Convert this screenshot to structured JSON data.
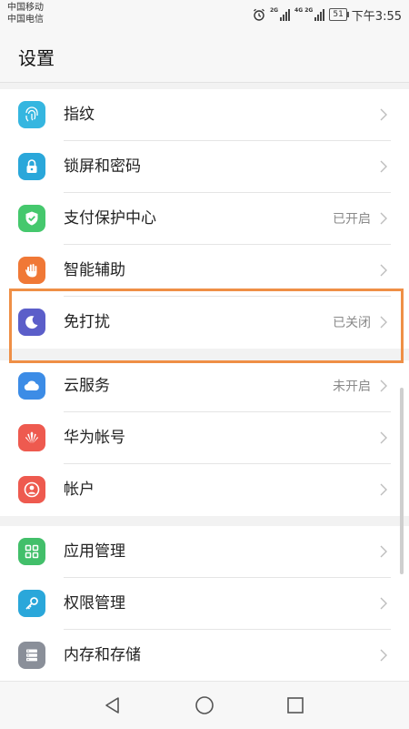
{
  "status_bar": {
    "carrier_1": "中国移动",
    "carrier_2": "中国电信",
    "signal_1_tag": "2G",
    "signal_2_tag": "4G 2G",
    "battery": "51",
    "time": "下午3:55",
    "icons": [
      "alarm-icon",
      "signal-icon",
      "battery-icon"
    ]
  },
  "header": {
    "title": "设置"
  },
  "groups": [
    {
      "items": [
        {
          "label": "指纹",
          "status": "",
          "icon": "fingerprint-icon",
          "color": "#35b6e0"
        },
        {
          "label": "锁屏和密码",
          "status": "",
          "icon": "lock-icon",
          "color": "#2aa7da"
        },
        {
          "label": "支付保护中心",
          "status": "已开启",
          "icon": "shield-check-icon",
          "color": "#45c86d"
        },
        {
          "label": "智能辅助",
          "status": "",
          "icon": "hand-icon",
          "color": "#f07836"
        },
        {
          "label": "免打扰",
          "status": "已关闭",
          "icon": "moon-icon",
          "color": "#5b5ec9"
        }
      ]
    },
    {
      "items": [
        {
          "label": "云服务",
          "status": "未开启",
          "icon": "cloud-icon",
          "color": "#3c8ce6"
        },
        {
          "label": "华为帐号",
          "status": "",
          "icon": "huawei-logo-icon",
          "color": "#ee5a4f"
        },
        {
          "label": "帐户",
          "status": "",
          "icon": "person-icon",
          "color": "#ee5a4f"
        }
      ]
    },
    {
      "items": [
        {
          "label": "应用管理",
          "status": "",
          "icon": "apps-grid-icon",
          "color": "#42bf6a"
        },
        {
          "label": "权限管理",
          "status": "",
          "icon": "key-icon",
          "color": "#2aa7da"
        },
        {
          "label": "内存和存储",
          "status": "",
          "icon": "storage-icon",
          "color": "#8a8f99"
        }
      ]
    }
  ],
  "nav_bar": {
    "icons": [
      "back-icon",
      "home-icon",
      "recents-icon"
    ]
  }
}
